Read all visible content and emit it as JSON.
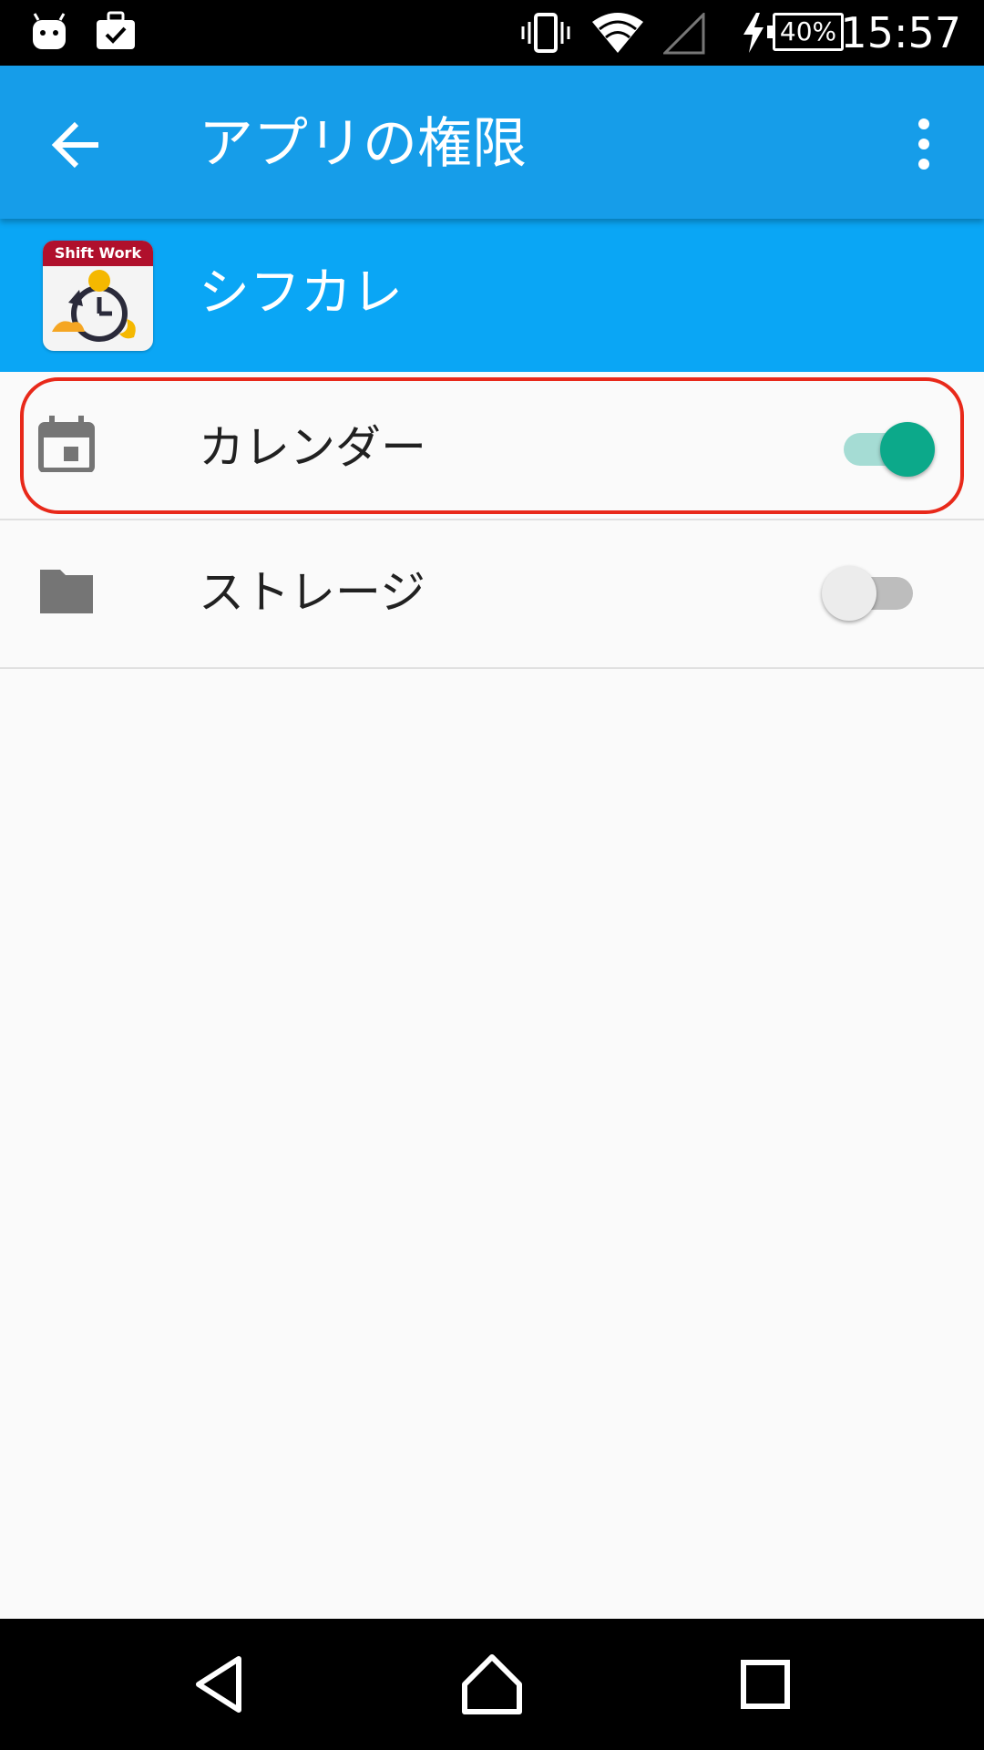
{
  "status_bar": {
    "time": "15:57",
    "battery_percent": "40%",
    "icons": [
      "android-icon",
      "briefcase-check-icon",
      "vibrate-icon",
      "wifi-icon",
      "signal-icon",
      "charging-icon",
      "battery-icon"
    ]
  },
  "app_bar": {
    "title": "アプリの権限",
    "back_icon": "arrow-back-icon",
    "overflow_icon": "more-vert-icon"
  },
  "app_header": {
    "name": "シフカレ",
    "icon_text": "Shift Work"
  },
  "permissions": [
    {
      "label": "カレンダー",
      "icon": "calendar-icon",
      "enabled": true
    },
    {
      "label": "ストレージ",
      "icon": "folder-icon",
      "enabled": false
    }
  ],
  "colors": {
    "app_bar": "#169de9",
    "app_header": "#0aa6f5",
    "switch_on": "#0ca98a",
    "highlight": "#e8291a"
  },
  "nav_bar": {
    "buttons": [
      "back-triangle-icon",
      "home-icon",
      "recents-icon"
    ]
  }
}
